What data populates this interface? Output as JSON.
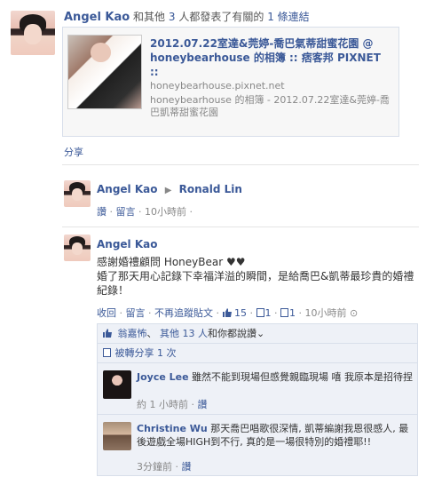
{
  "story1": {
    "actor": "Angel Kao",
    "text_and_others": "和其他",
    "others_count": "3",
    "text_people": "人都發表了有關的",
    "link_count": "1",
    "text_links": "條連結"
  },
  "link_card": {
    "title": "2012.07.22室達&莞婷-喬巴氣蒂甜蜜花園 @ honeybearhouse 的相簿 :: 痞客邦 PIXNET ::",
    "domain": "honeybearhouse.pixnet.net",
    "description": "honeybearhouse 的相簿 - 2012.07.22室達&莞婷-喬巴凱蒂甜蜜花園"
  },
  "share_label": "分享",
  "story2": {
    "actor": "Angel Kao",
    "target": "Ronald Lin",
    "like_label": "讚",
    "comment_label": "留言",
    "time": "10小時前"
  },
  "story3": {
    "actor": "Angel Kao",
    "message_line1": "感謝婚禮顧問 HoneyBear ♥♥",
    "message_line2": "婚了那天用心記錄下幸福洋溢的瞬間，是給喬巴&凱蒂最珍貴的婚禮紀錄！",
    "actions": {
      "retract": "收回",
      "comment": "留言",
      "unfollow": "不再追蹤貼文",
      "likes": "15",
      "comments": "1",
      "shares": "1",
      "time": "10小時前"
    },
    "feedback": {
      "likers": "翁嘉怖",
      "others_prefix": "其他",
      "others_count": "13",
      "others_suffix": "人",
      "liked_text": "和你都說讚",
      "shared_label": "被轉分享",
      "shared_count": "1",
      "shared_suffix": "次"
    },
    "comments": [
      {
        "author": "Joyce Lee",
        "text": "雖然不能到現場但感覺親臨現場 嘻 我原本是招待捏",
        "time": "約 1 小時前",
        "like_label": "讚"
      },
      {
        "author": "Christine Wu",
        "text": "那天喬巴唱歌很深情, 凱蒂編謝我恩很感人, 最後遊戲全場HIGH到不行, 真的是一場很特別的婚禮耶!!",
        "time": "3分鐘前",
        "like_label": "讚"
      }
    ]
  },
  "colors": {
    "link": "#3b5998",
    "muted": "#888888",
    "feedback_bg": "#eef1f7",
    "border": "#d8dfea"
  }
}
